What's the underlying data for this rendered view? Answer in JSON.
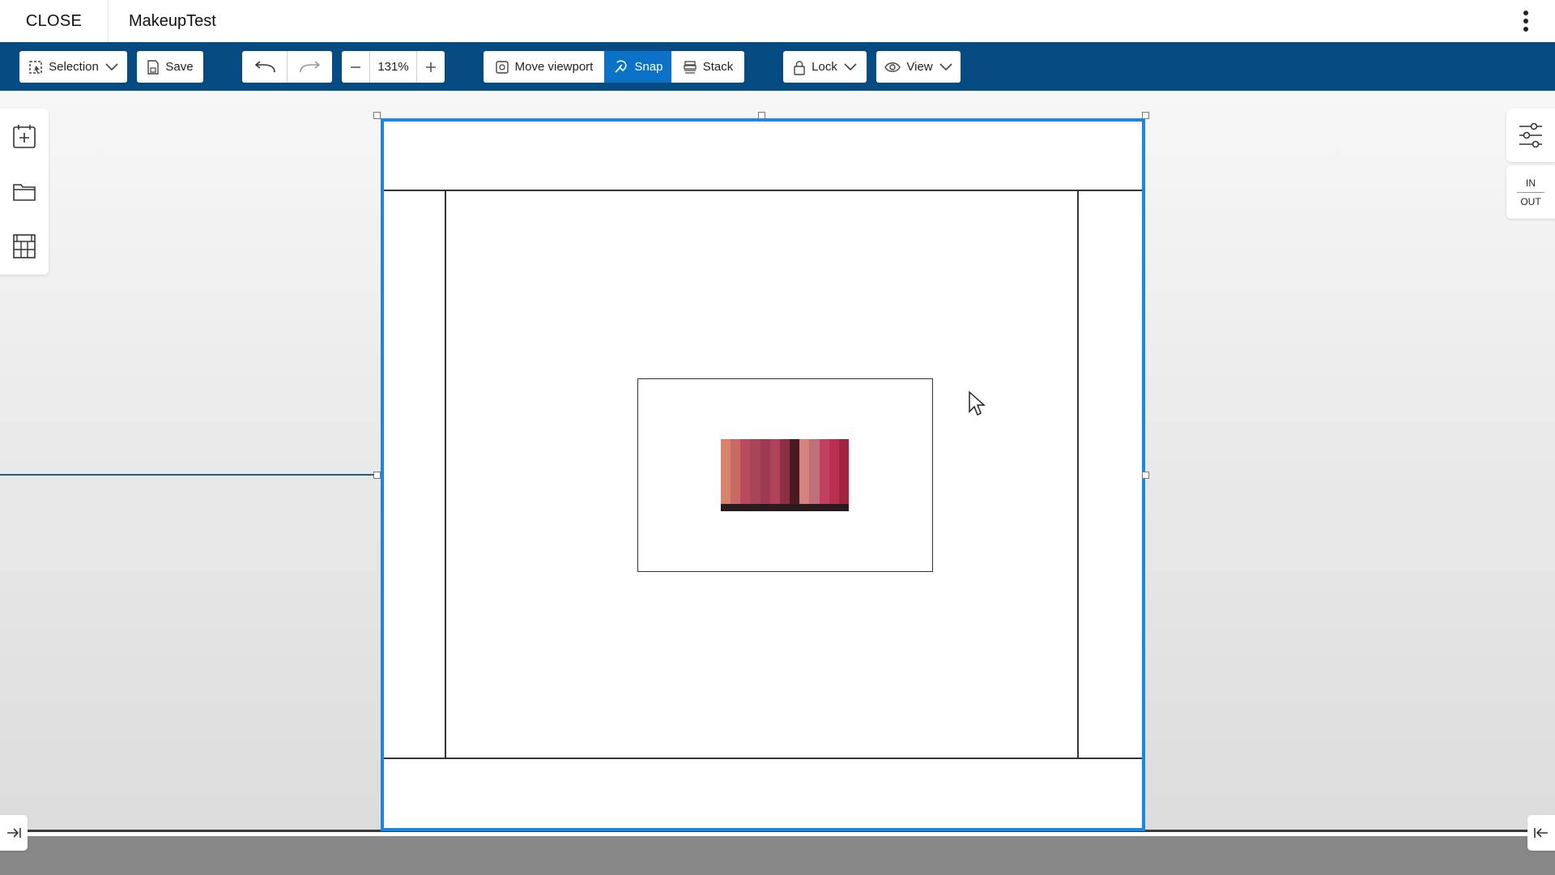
{
  "header": {
    "close_label": "CLOSE",
    "title": "MakeupTest",
    "menu_icon": "kebab-menu-icon"
  },
  "toolbar": {
    "selection_label": "Selection",
    "save_label": "Save",
    "zoom_value": "131%",
    "move_viewport_label": "Move viewport",
    "snap_label": "Snap",
    "stack_label": "Stack",
    "lock_label": "Lock",
    "view_label": "View"
  },
  "right_panel": {
    "in_label": "IN",
    "out_label": "OUT"
  },
  "colors": {
    "toolbar_bg": "#054a80",
    "active_accent": "#0b72c8",
    "selection_border": "#1c86e3"
  },
  "palette_swatches": [
    "#d9826e",
    "#c86a64",
    "#b84a5d",
    "#a84457",
    "#9b3a55",
    "#b0435a",
    "#8d2f47",
    "#4a1a22",
    "#d4847c",
    "#c0707a",
    "#c24062",
    "#b8304e",
    "#a1243f"
  ]
}
